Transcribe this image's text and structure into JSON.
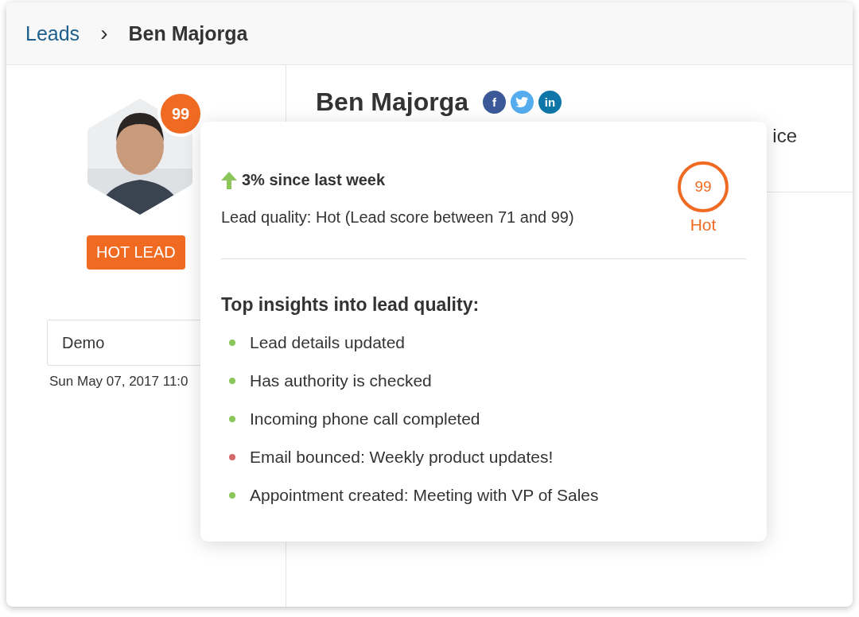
{
  "breadcrumb": {
    "parent": "Leads",
    "separator": "›",
    "current": "Ben Majorga"
  },
  "lead": {
    "score": "99",
    "badge": "HOT LEAD",
    "field": {
      "value": "Demo"
    },
    "date": "Sun May 07, 2017 11:0"
  },
  "profile": {
    "name": "Ben Majorga",
    "socials": [
      {
        "kind": "facebook",
        "label": "f"
      },
      {
        "kind": "twitter"
      },
      {
        "kind": "linkedin",
        "label": "in"
      }
    ],
    "partial_text": "ice"
  },
  "popup": {
    "trend": "3% since last week",
    "quality": "Lead quality: Hot (Lead score between 71 and 99)",
    "score": "99",
    "rating": "Hot",
    "heading": "Top insights into lead quality:",
    "insights": [
      {
        "text": "Lead details updated",
        "color": "#8cc65a"
      },
      {
        "text": "Has authority is checked",
        "color": "#8cc65a"
      },
      {
        "text": "Incoming phone call completed",
        "color": "#8cc65a"
      },
      {
        "text": "Email bounced: Weekly product updates!",
        "color": "#d46a6a"
      },
      {
        "text": "Appointment created: Meeting with VP of Sales",
        "color": "#8cc65a"
      }
    ]
  }
}
